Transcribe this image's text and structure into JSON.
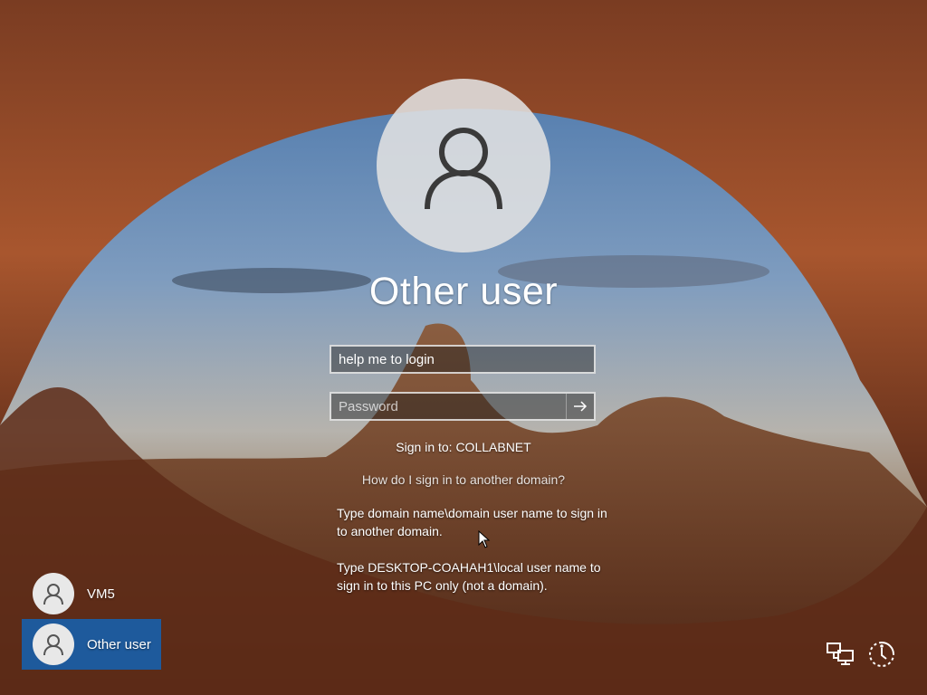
{
  "login": {
    "title": "Other user",
    "username_value": "help me to login",
    "password_placeholder": "Password",
    "sign_in_to": "Sign in to: COLLABNET",
    "domain_help_link": "How do I sign in to another domain?",
    "help_text_1": "Type domain name\\domain user name to sign in to another domain.",
    "help_text_2": "Type DESKTOP-COAHAH1\\local user name to sign in to this PC only (not a domain)."
  },
  "users": [
    {
      "label": "VM5",
      "icon": "user-icon"
    },
    {
      "label": "Other user",
      "icon": "user-icon",
      "selected": true
    }
  ],
  "corner_icons": [
    "network-icon",
    "ease-of-access-icon"
  ],
  "colors": {
    "selected_tile": "#1e5a9c",
    "avatar_bg": "#e1e1e1"
  }
}
